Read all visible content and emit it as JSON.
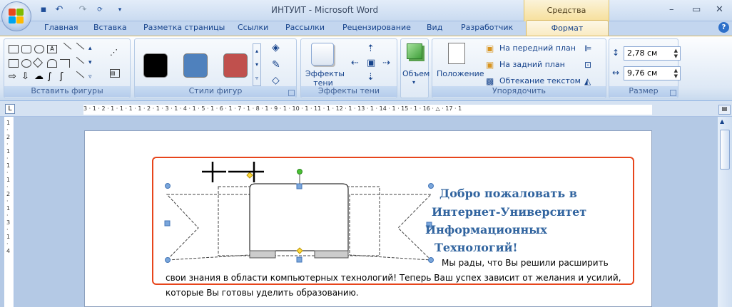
{
  "app": {
    "title": "ИНТУИТ - Microsoft Word",
    "context_tab_label": "Средства рисования"
  },
  "window": {
    "min": "–",
    "max": "▭",
    "close": "✕"
  },
  "tabs": [
    "Главная",
    "Вставка",
    "Разметка страницы",
    "Ссылки",
    "Рассылки",
    "Рецензирование",
    "Вид",
    "Разработчик"
  ],
  "active_tab": "Формат",
  "ribbon": {
    "insert_shapes": {
      "label": "Вставить фигуры"
    },
    "shape_styles": {
      "label": "Стили фигур",
      "colors": [
        "#000000",
        "#4f81bd",
        "#c0504d"
      ]
    },
    "shadow": {
      "button": "Эффекты тени",
      "label": "Эффекты тени"
    },
    "volume": {
      "button": "Объем"
    },
    "arrange": {
      "position": "Положение",
      "front": "На передний план",
      "back": "На задний план",
      "wrap": "Обтекание текстом",
      "label": "Упорядочить"
    },
    "size": {
      "height": "2,78 см",
      "width": "9,76 см",
      "label": "Размер"
    }
  },
  "ruler": {
    "text": "3 · 1 · 2 · 1 · 1 · 1 · 1 · 2 · 1 · 3 · 1 · 4 · 1 · 5 · 1 · 6 · 1 · 7 · 1 · 8 · 1 · 9 · 1 · 10 · 1 · 11 · 1 · 12 · 1 · 13 · 1 · 14 · 1 · 15 · 1 · 16 · △ · 17 · 1"
  },
  "vruler": {
    "text": "1 · 2 · 1 · 1 · 1 · 2 · 1 · 3 · 1 · 4"
  },
  "document": {
    "heading_lines": [
      "Добро пожаловать в",
      "Интернет-Университет",
      "Информационных",
      "Технологий!"
    ],
    "paragraph_lines": [
      "Мы рады, что Вы решили расширить",
      "свои знания в области компьютерных технологий! Теперь Ваш успех зависит от желания и усилий,",
      "которые Вы готовы уделить образованию."
    ]
  }
}
